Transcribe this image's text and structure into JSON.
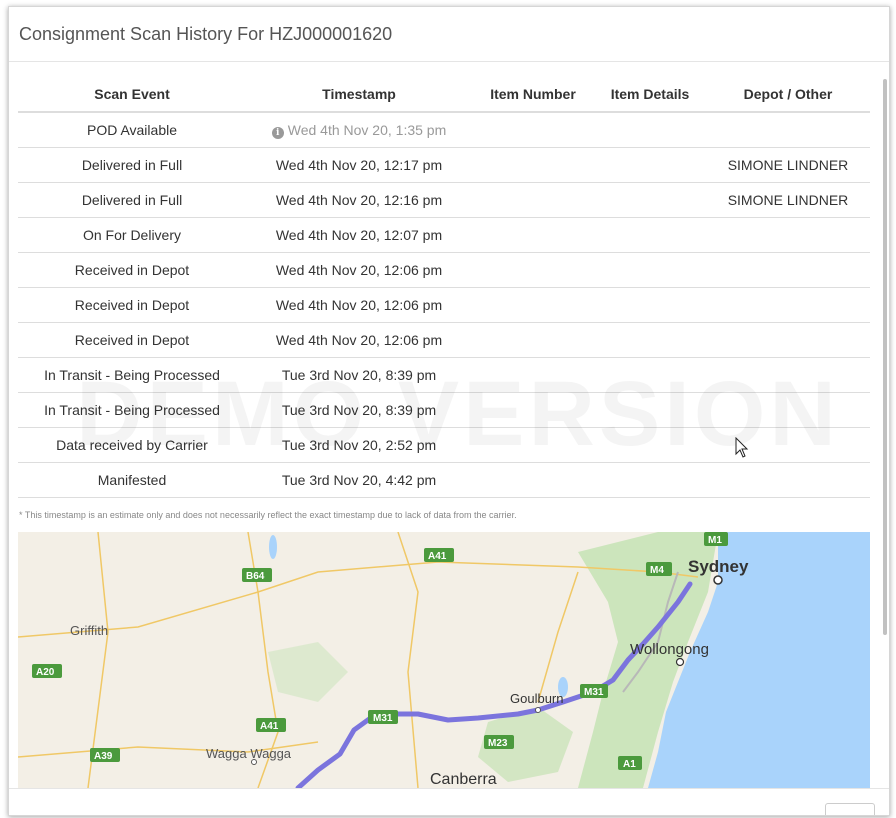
{
  "modal": {
    "title": "Consignment Scan History For HZJ000001620"
  },
  "table": {
    "headers": {
      "event": "Scan Event",
      "timestamp": "Timestamp",
      "item_number": "Item Number",
      "item_details": "Item Details",
      "depot": "Depot / Other"
    },
    "rows": [
      {
        "event": "POD Available",
        "timestamp": "Wed 4th Nov 20, 1:35 pm",
        "item_number": "",
        "item_details": "",
        "depot": ""
      },
      {
        "event": "Delivered in Full",
        "timestamp": "Wed 4th Nov 20, 12:17 pm",
        "item_number": "",
        "item_details": "",
        "depot": "SIMONE LINDNER"
      },
      {
        "event": "Delivered in Full",
        "timestamp": "Wed 4th Nov 20, 12:16 pm",
        "item_number": "",
        "item_details": "",
        "depot": "SIMONE LINDNER"
      },
      {
        "event": "On For Delivery",
        "timestamp": "Wed 4th Nov 20, 12:07 pm",
        "item_number": "",
        "item_details": "",
        "depot": ""
      },
      {
        "event": "Received in Depot",
        "timestamp": "Wed 4th Nov 20, 12:06 pm",
        "item_number": "",
        "item_details": "",
        "depot": ""
      },
      {
        "event": "Received in Depot",
        "timestamp": "Wed 4th Nov 20, 12:06 pm",
        "item_number": "",
        "item_details": "",
        "depot": ""
      },
      {
        "event": "Received in Depot",
        "timestamp": "Wed 4th Nov 20, 12:06 pm",
        "item_number": "",
        "item_details": "",
        "depot": ""
      },
      {
        "event": "In Transit - Being Processed",
        "timestamp": "Tue 3rd Nov 20, 8:39 pm",
        "item_number": "",
        "item_details": "",
        "depot": ""
      },
      {
        "event": "In Transit - Being Processed",
        "timestamp": "Tue 3rd Nov 20, 8:39 pm",
        "item_number": "",
        "item_details": "",
        "depot": ""
      },
      {
        "event": "Data received by Carrier",
        "timestamp": "Tue 3rd Nov 20, 2:52 pm",
        "item_number": "",
        "item_details": "",
        "depot": ""
      },
      {
        "event": "Manifested",
        "timestamp": "Tue 3rd Nov 20, 4:42 pm",
        "item_number": "",
        "item_details": "",
        "depot": ""
      }
    ]
  },
  "watermark": "DEMO VERSION",
  "footnote": "* This timestamp is an estimate only and does not necessarily reflect the exact timestamp due to lack of data from the carrier.",
  "map": {
    "places": {
      "sydney": "Sydney",
      "wollongong": "Wollongong",
      "goulburn": "Goulburn",
      "canberra": "Canberra",
      "wagga": "Wagga Wagga",
      "griffith": "Griffith"
    },
    "roads": {
      "m1": "M1",
      "m4": "M4",
      "m31_a": "M31",
      "m31_b": "M31",
      "m23": "M23",
      "a1": "A1",
      "a41_top": "A41",
      "a41_mid": "A41",
      "b64": "B64",
      "a20": "A20",
      "a39": "A39"
    },
    "colors": {
      "land": "#f3efe6",
      "water": "#a9d3fb",
      "park": "#c4e3b4",
      "route": "#7b74dd",
      "road_shield": "#4b9a3d"
    }
  },
  "icons": {
    "info": "info-circle-icon",
    "cursor": "mouse-pointer-icon"
  }
}
